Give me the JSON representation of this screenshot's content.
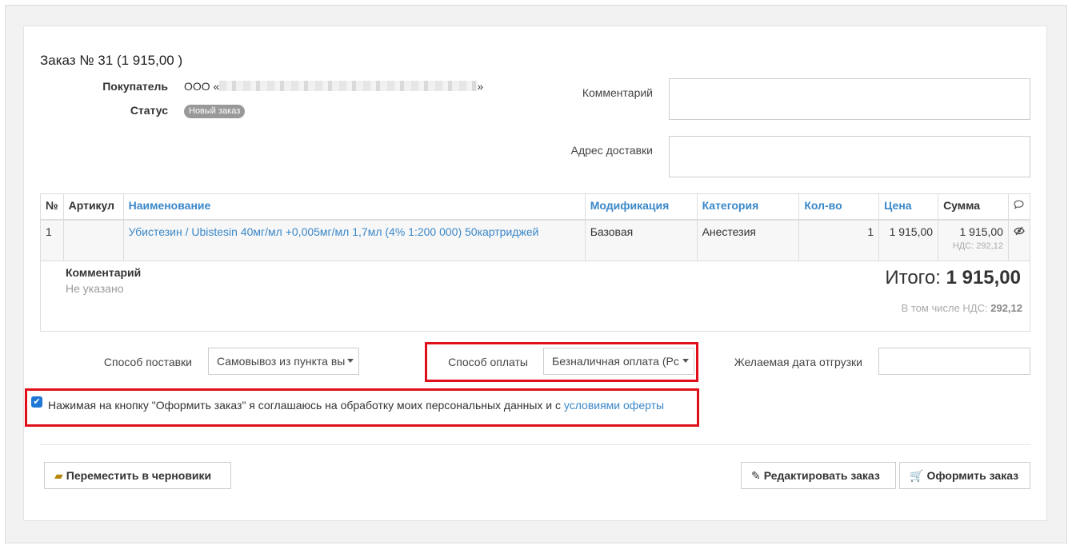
{
  "order": {
    "title": "Заказ № 31 (1 915,00 )",
    "buyer_label": "Покупатель",
    "buyer_prefix": "ООО «",
    "buyer_suffix": "»",
    "status_label": "Статус",
    "status_value": "Новый заказ"
  },
  "fields": {
    "comment_label": "Комментарий",
    "address_label": "Адрес доставки"
  },
  "table": {
    "headers": {
      "num": "№",
      "article": "Артикул",
      "name": "Наименование",
      "modification": "Модификация",
      "category": "Категория",
      "qty": "Кол-во",
      "price": "Цена",
      "sum": "Сумма"
    },
    "rows": [
      {
        "num": "1",
        "article": "",
        "name": "Убистезин / Ubistesin 40мг/мл +0,005мг/мл 1,7мл (4% 1:200 000) 50картриджей",
        "modification": "Базовая",
        "category": "Анестезия",
        "qty": "1",
        "price": "1 915,00",
        "sum": "1 915,00",
        "vat": "НДС: 292,12"
      }
    ]
  },
  "summary": {
    "comment_label": "Комментарий",
    "comment_value": "Не указано",
    "total_label": "Итого:",
    "total_value": "1 915,00",
    "vat_label": "В том числе НДС:",
    "vat_value": "292,12"
  },
  "shipping": {
    "delivery_label": "Способ поставки",
    "delivery_value": "Самовывоз из пункта вы",
    "payment_label": "Способ оплаты",
    "payment_value": "Безналичная оплата (Рс",
    "date_label": "Желаемая дата отгрузки",
    "date_value": ""
  },
  "agreement": {
    "checked": true,
    "text": "Нажимая на кнопку \"Оформить заказ\" я соглашаюсь на обработку моих персональных данных и с ",
    "link": "условиями оферты"
  },
  "buttons": {
    "draft": "Переместить в черновики",
    "edit": "Редактировать заказ",
    "order": "Оформить заказ"
  },
  "colors": {
    "link": "#3a87c8",
    "highlight": "#e0101b",
    "badge": "#999999",
    "checkbox": "#1e78d6"
  }
}
